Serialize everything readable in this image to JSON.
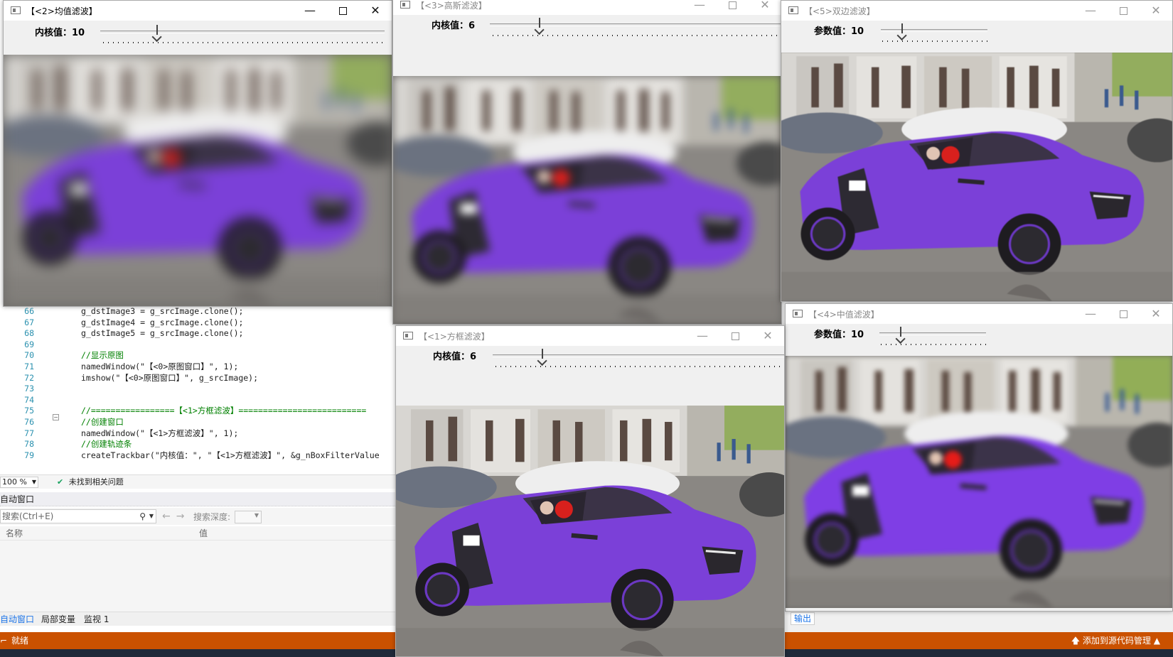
{
  "editor": {
    "lines": [
      {
        "num": "66",
        "text": "g_dstImage3 = g_srcImage.clone();",
        "kind": "code"
      },
      {
        "num": "67",
        "text": "g_dstImage4 = g_srcImage.clone();",
        "kind": "code"
      },
      {
        "num": "68",
        "text": "g_dstImage5 = g_srcImage.clone();",
        "kind": "code"
      },
      {
        "num": "69",
        "text": "",
        "kind": "code"
      },
      {
        "num": "70",
        "text": "//显示原图",
        "kind": "comment"
      },
      {
        "num": "71",
        "text": "namedWindow(\"【<0>原图窗口】\", 1);",
        "kind": "code"
      },
      {
        "num": "72",
        "text": "imshow(\"【<0>原图窗口】\", g_srcImage);",
        "kind": "code"
      },
      {
        "num": "73",
        "text": "",
        "kind": "code"
      },
      {
        "num": "74",
        "text": "",
        "kind": "code"
      },
      {
        "num": "75",
        "text": "//=================【<1>方框滤波】==========================",
        "kind": "comment"
      },
      {
        "num": "76",
        "text": "//创建窗口",
        "kind": "comment"
      },
      {
        "num": "77",
        "text": "namedWindow(\"【<1>方框滤波】\", 1);",
        "kind": "code"
      },
      {
        "num": "78",
        "text": "//创建轨迹条",
        "kind": "comment"
      },
      {
        "num": "79",
        "text": "createTrackbar(\"内核值：\", \"【<1>方框滤波】\", &g_nBoxFilterValue",
        "kind": "code"
      }
    ],
    "zoom": "100 %",
    "issues_text": "未找到相关问题"
  },
  "autos_panel": {
    "title": "自动窗口",
    "search_placeholder": "搜索(Ctrl+E)",
    "depth_label": "搜索深度:",
    "col_name": "名称",
    "col_value": "值",
    "tabs": [
      "自动窗口",
      "局部变量",
      "监视 1"
    ]
  },
  "output_tab": "输出",
  "status": {
    "ready": "就绪",
    "source_control": "添加到源代码管理"
  },
  "windows": {
    "mean": {
      "title": "【<2>均值滤波】",
      "param_label": "内核值：",
      "param_value": "10",
      "slider_fraction": 0.2,
      "active": true
    },
    "gaussian": {
      "title": "【<3>高斯滤波】",
      "param_label": "内核值：",
      "param_value": "6",
      "slider_fraction": 0.17,
      "active": false
    },
    "bilateral": {
      "title": "【<5>双边滤波】",
      "param_label": "参数值：",
      "param_value": "10",
      "slider_fraction": 0.2,
      "active": false
    },
    "median": {
      "title": "【<4>中值滤波】",
      "param_label": "参数值：",
      "param_value": "10",
      "slider_fraction": 0.2,
      "active": false
    },
    "box": {
      "title": "【<1>方框滤波】",
      "param_label": "内核值：",
      "param_value": "6",
      "slider_fraction": 0.17,
      "active": false
    }
  },
  "window_controls": {
    "minimize": "—",
    "close": "✕"
  },
  "icons": {
    "ok": "check-circle-icon",
    "search": "search-icon",
    "back": "arrow-left-icon",
    "forward": "arrow-right-icon",
    "up": "arrow-up-icon"
  },
  "colors": {
    "status_bar": "#ca5100",
    "car": "#7a3fd6",
    "accent_blue": "#1a73e8"
  }
}
